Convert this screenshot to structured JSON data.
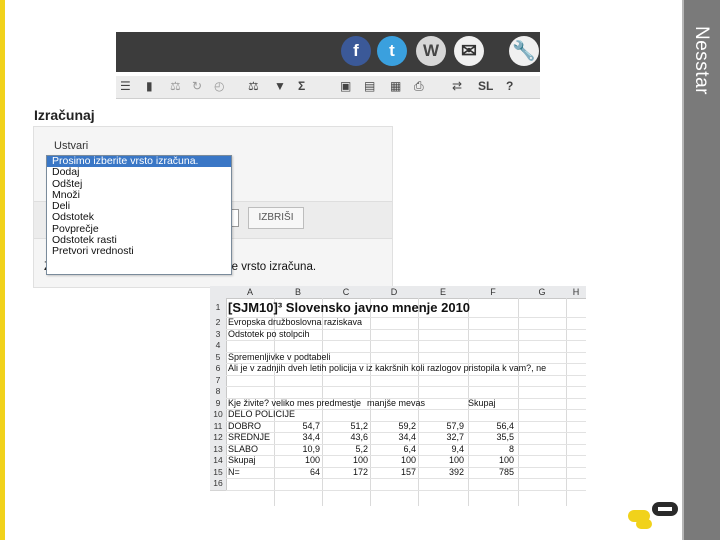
{
  "side_label": "Nesstar",
  "toolbar": {
    "social": [
      {
        "icon": "facebook-icon",
        "glyph": "f"
      },
      {
        "icon": "twitter-icon",
        "glyph": "t"
      },
      {
        "icon": "wordpress-icon",
        "glyph": "W"
      },
      {
        "icon": "mail-icon",
        "glyph": "✉"
      },
      {
        "icon": "wrench-icon",
        "glyph": "🔧"
      }
    ],
    "tools": [
      {
        "icon": "table-icon",
        "glyph": "☰"
      },
      {
        "icon": "bar-chart-icon",
        "glyph": "▮"
      },
      {
        "icon": "weight-icon",
        "glyph": "⚖"
      },
      {
        "icon": "refresh-icon",
        "glyph": "↻"
      },
      {
        "icon": "clock-icon",
        "glyph": "◴"
      },
      {
        "icon": "balance-icon",
        "glyph": "⚖"
      },
      {
        "icon": "filter-icon",
        "glyph": "▼"
      },
      {
        "icon": "sigma-icon",
        "glyph": "Σ"
      },
      {
        "icon": "save-icon",
        "glyph": "▣"
      },
      {
        "icon": "export-icon",
        "glyph": "▤"
      },
      {
        "icon": "spreadsheet-icon",
        "glyph": "▦"
      },
      {
        "icon": "print-icon",
        "glyph": "⎙"
      },
      {
        "icon": "swap-icon",
        "glyph": "⇄"
      },
      {
        "icon": "language-icon",
        "glyph": "SL"
      },
      {
        "icon": "help-icon",
        "glyph": "?"
      }
    ]
  },
  "section_title": "Izračunaj",
  "form": {
    "ustvari_label": "Ustvari",
    "options": [
      "Prosimo izberite vrsto izračuna.",
      "Dodaj",
      "Odštej",
      "Množi",
      "Deli",
      "Odstotek",
      "Povprečje",
      "Odstotek rasti",
      "Pretvori vrednosti"
    ],
    "selected_index": 0,
    "izbrisi_label": "IZBRIŠI",
    "status_prefix": "Z",
    "status_text": "izberite vrsto izračuna."
  },
  "sheet": {
    "columns": [
      "A",
      "B",
      "C",
      "D",
      "E",
      "F",
      "G",
      "H"
    ],
    "rows": [
      "1",
      "2",
      "3",
      "4",
      "5",
      "6",
      "7",
      "8",
      "9",
      "10",
      "11",
      "12",
      "13",
      "14",
      "15",
      "16"
    ],
    "title": "[SJM10]³ Slovensko javno mnenje 2010",
    "line2": "Evropska družboslovna raziskava",
    "line3": "Odstotek po stolpcih",
    "line5": "Spremenljivke v podtabeli",
    "line6": "Ali je v zadnjih dveh letih policija v iz kakršnih koli razlogov pristopila k vam?, ne",
    "header_a": "Kje živite? veliko mes predmestje",
    "header_d": "manjše mevas",
    "header_f": "Skupaj",
    "row9": "DELO POLICIJE",
    "data_rows": [
      {
        "label": "DOBRO",
        "values": [
          "54,7",
          "51,2",
          "59,2",
          "57,9",
          "56,4"
        ]
      },
      {
        "label": "SREDNJE",
        "values": [
          "34,4",
          "43,6",
          "34,4",
          "32,7",
          "35,5"
        ]
      },
      {
        "label": "SLABO",
        "values": [
          "10,9",
          "5,2",
          "6,4",
          "9,4",
          "8"
        ]
      },
      {
        "label": "Skupaj",
        "values": [
          "100",
          "100",
          "100",
          "100",
          "100"
        ]
      },
      {
        "label": "N=",
        "values": [
          "64",
          "172",
          "157",
          "392",
          "785"
        ]
      }
    ]
  }
}
